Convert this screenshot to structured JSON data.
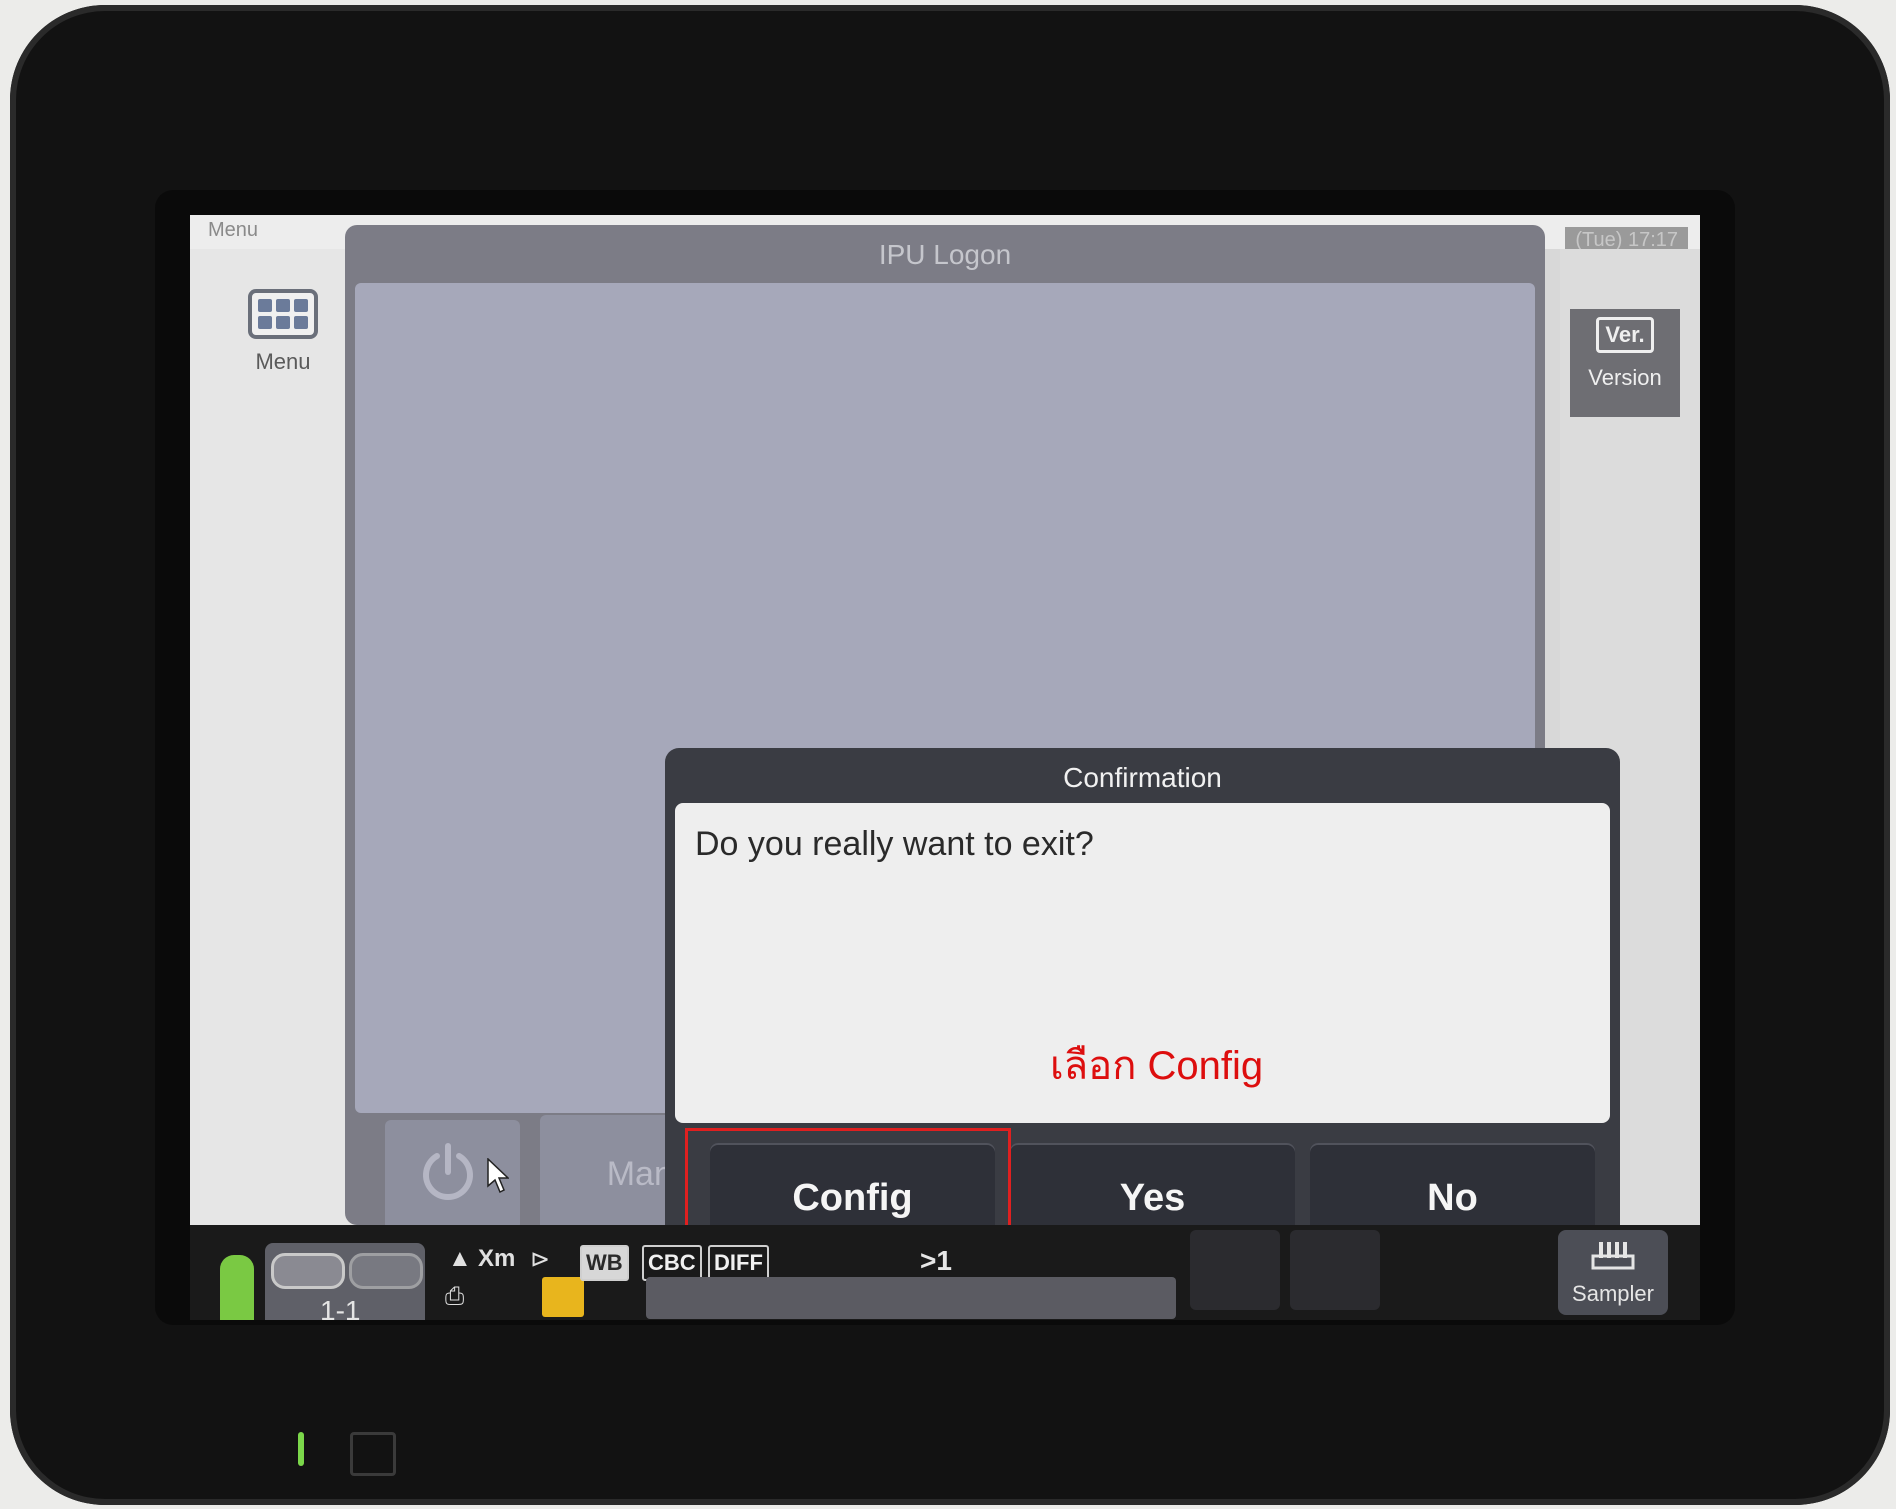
{
  "header": {
    "menu_small_label": "Menu",
    "datetime": "(Tue) 17:17"
  },
  "sidebar": {
    "menu_label": "Menu",
    "version_icon_text": "Ver.",
    "version_label": "Version"
  },
  "logon_window": {
    "title": "IPU Logon",
    "manual_label": "Manual"
  },
  "dialog": {
    "title": "Confirmation",
    "message": "Do you really want to exit?",
    "annotation": "เลือก Config",
    "buttons": {
      "config": "Config",
      "yes": "Yes",
      "no": "No"
    }
  },
  "statusbar": {
    "rack_label": "1-1",
    "xm_label": "Xm",
    "tags": [
      "WB",
      "CBC",
      "DIFF"
    ],
    "count_label": ">1",
    "sampler_label": "Sampler"
  },
  "colors": {
    "dialog_bg": "#3a3c43",
    "annotation_red": "#dd0e0e",
    "status_green": "#7ac943",
    "status_yellow": "#e8b51d"
  }
}
